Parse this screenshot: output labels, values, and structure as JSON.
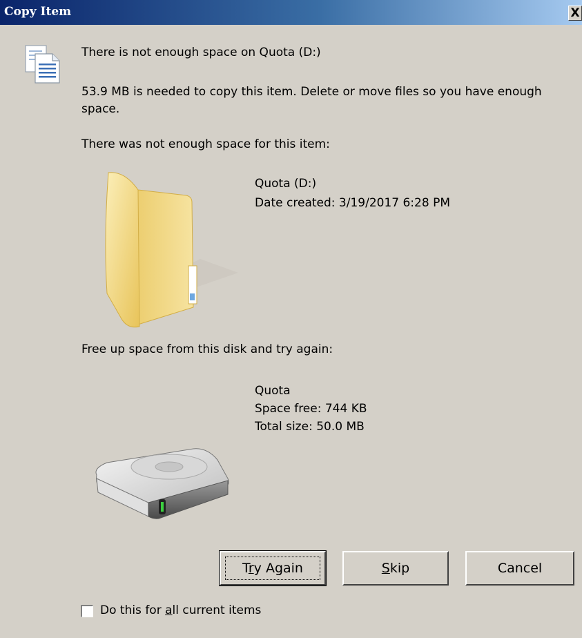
{
  "window": {
    "title": "Copy Item",
    "close_label": "X"
  },
  "message": {
    "heading": "There is not enough space on Quota (D:)",
    "detail": "53.9 MB is needed to copy this item. Delete or move files so you have enough space.",
    "item_label": "There was not enough space for this item:"
  },
  "item": {
    "name": "Quota (D:)",
    "date_created": "Date created: 3/19/2017 6:28 PM",
    "icon": "folder-icon"
  },
  "disk_section": {
    "label": "Free up space from this disk and try again:",
    "name": "Quota",
    "space_free": "Space free: 744 KB",
    "total_size": "Total size: 50.0 MB",
    "icon": "hard-drive-icon"
  },
  "buttons": {
    "try_again": {
      "pre": "T",
      "accel": "r",
      "post": "y Again"
    },
    "skip": {
      "pre": "",
      "accel": "S",
      "post": "kip"
    },
    "cancel": "Cancel"
  },
  "checkbox": {
    "pre": "Do this for ",
    "accel": "a",
    "post": "ll current items",
    "checked": false
  },
  "colors": {
    "dialog_bg": "#d4d0c8",
    "titlebar_start": "#0a246a",
    "titlebar_end": "#a6caf0",
    "folder": "#f2d77e"
  }
}
